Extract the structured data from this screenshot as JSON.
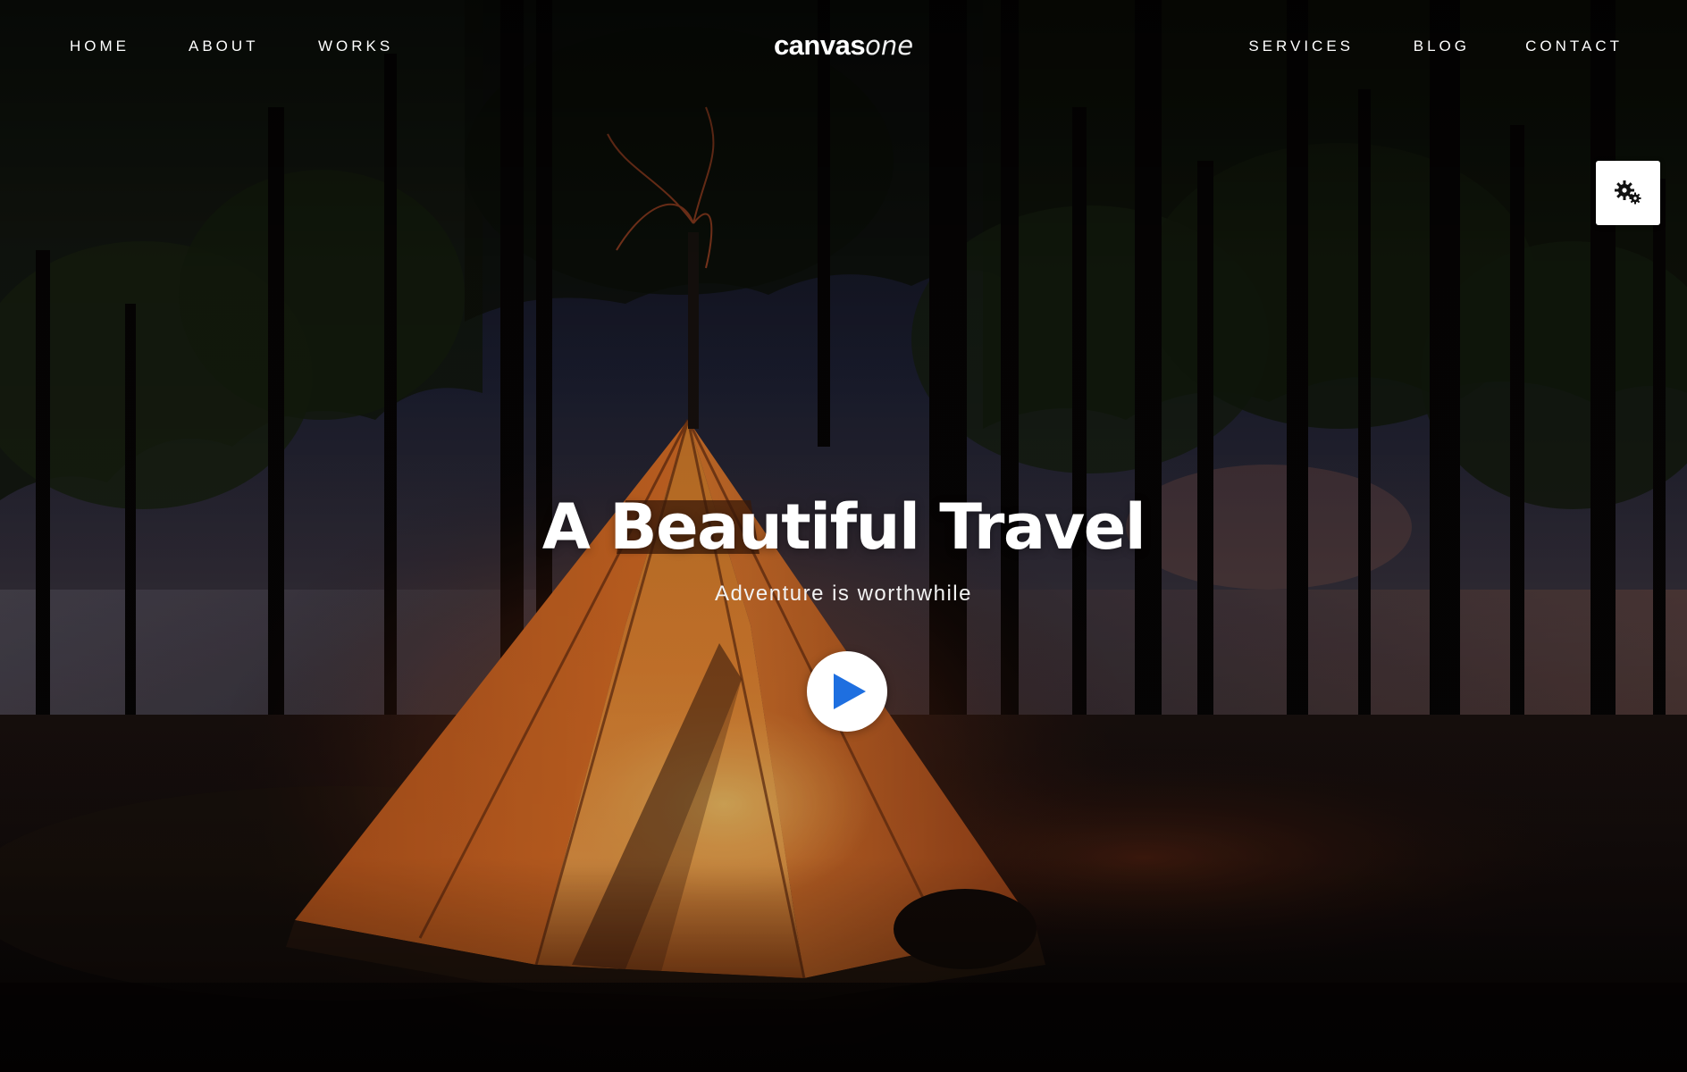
{
  "nav": {
    "left": [
      "HOME",
      "ABOUT",
      "WORKS"
    ],
    "right": [
      "SERVICES",
      "BLOG",
      "CONTACT"
    ]
  },
  "logo": {
    "strong": "canvas",
    "light": "one"
  },
  "hero": {
    "title": "A Beautiful Travel",
    "subtitle": "Adventure is worthwhile",
    "background": "night forest campsite with glowing orange teepee tent",
    "play_icon": "play-icon"
  },
  "settings": {
    "icon": "gears-icon"
  },
  "colors": {
    "tent_orange": "#f0772a",
    "play_accent": "#1e6fe0",
    "text": "#ffffff",
    "overlay_dark": "#0b0708"
  }
}
